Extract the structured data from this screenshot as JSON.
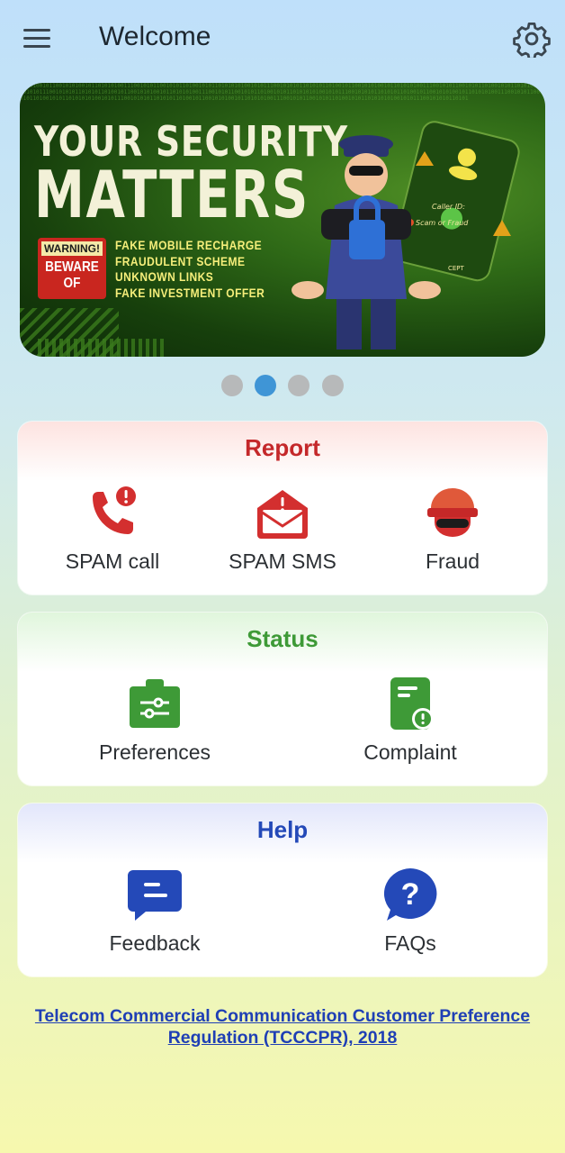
{
  "header": {
    "title": "Welcome",
    "menu_icon": "hamburger-menu-icon",
    "settings_icon": "gear-icon"
  },
  "banner": {
    "headline_line1": "YOUR SECURITY",
    "headline_line2": "MATTERS",
    "warning_label": "WARNING!",
    "beware_label": "BEWARE OF",
    "threats": [
      "FAKE MOBILE RECHARGE",
      "FRAUDULENT SCHEME",
      "UNKNOWN LINKS",
      "FAKE INVESTMENT OFFER"
    ],
    "phone_caller_label": "Caller ID:",
    "phone_status_label": "Scam or Fraud",
    "phone_footer": "CEPT"
  },
  "carousel": {
    "count": 4,
    "active_index": 1,
    "active_color": "#3f95d6",
    "inactive_color": "#b7b9ba"
  },
  "report": {
    "title": "Report",
    "color": "#c4282a",
    "items": [
      {
        "label": "SPAM call",
        "icon": "phone-alert-icon"
      },
      {
        "label": "SPAM SMS",
        "icon": "envelope-alert-icon"
      },
      {
        "label": "Fraud",
        "icon": "masked-fraudster-icon"
      }
    ]
  },
  "status": {
    "title": "Status",
    "color": "#3e9a37",
    "items": [
      {
        "label": "Preferences",
        "icon": "briefcase-sliders-icon"
      },
      {
        "label": "Complaint",
        "icon": "document-alert-icon"
      }
    ]
  },
  "help": {
    "title": "Help",
    "color": "#2449b8",
    "items": [
      {
        "label": "Feedback",
        "icon": "chat-bubble-icon"
      },
      {
        "label": "FAQs",
        "icon": "question-bubble-icon"
      }
    ]
  },
  "footer": {
    "link_line1": "Telecom Commercial Communication Customer Preference",
    "link_line2": "Regulation (TCCCPR), 2018"
  }
}
